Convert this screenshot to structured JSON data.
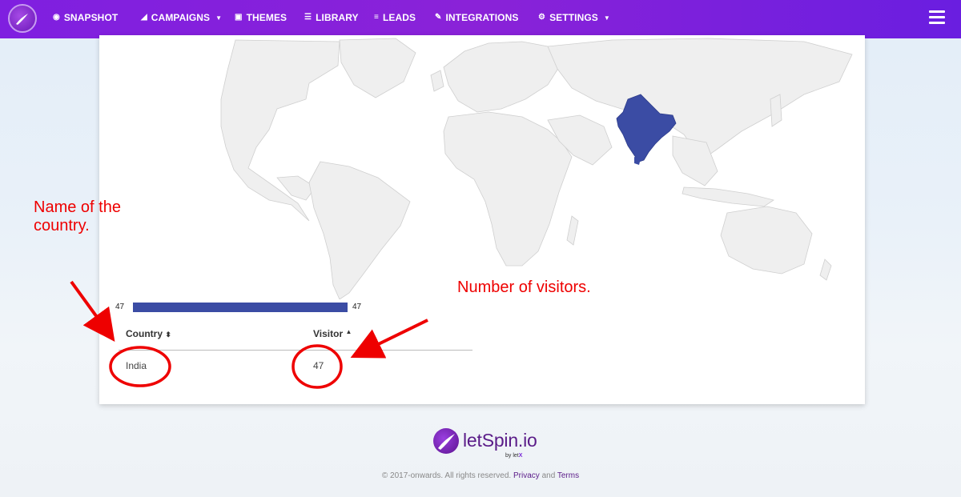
{
  "nav": {
    "items": [
      {
        "label": "SNAPSHOT",
        "icon": "dashboard-icon"
      },
      {
        "label": "CAMPAIGNS",
        "icon": "paper-plane-icon",
        "caret": true
      },
      {
        "label": "THEMES",
        "icon": "image-icon"
      },
      {
        "label": "LIBRARY",
        "icon": "library-icon"
      },
      {
        "label": "LEADS",
        "icon": "list-icon"
      },
      {
        "label": "INTEGRATIONS",
        "icon": "plug-icon"
      },
      {
        "label": "SETTINGS",
        "icon": "gears-icon",
        "caret": true
      }
    ]
  },
  "map": {
    "highlighted_country": "India",
    "highlight_color": "#3b4ca4",
    "land_color": "#efefef"
  },
  "scale": {
    "min": "47",
    "max": "47"
  },
  "table": {
    "headers": {
      "country": "Country",
      "visitor": "Visitor"
    },
    "rows": [
      {
        "country": "India",
        "visitor": "47"
      }
    ]
  },
  "annotations": {
    "country_line1": "Name of the",
    "country_line2": "country.",
    "visitors": "Number of visitors.",
    "color": "#ee0000"
  },
  "footer": {
    "logo_text": "letSpin.io",
    "logo_by_prefix": "by let",
    "logo_by_suffix": "X",
    "copyright": "© 2017-onwards. All rights reserved.",
    "privacy": "Privacy",
    "and": "and",
    "terms": "Terms"
  }
}
